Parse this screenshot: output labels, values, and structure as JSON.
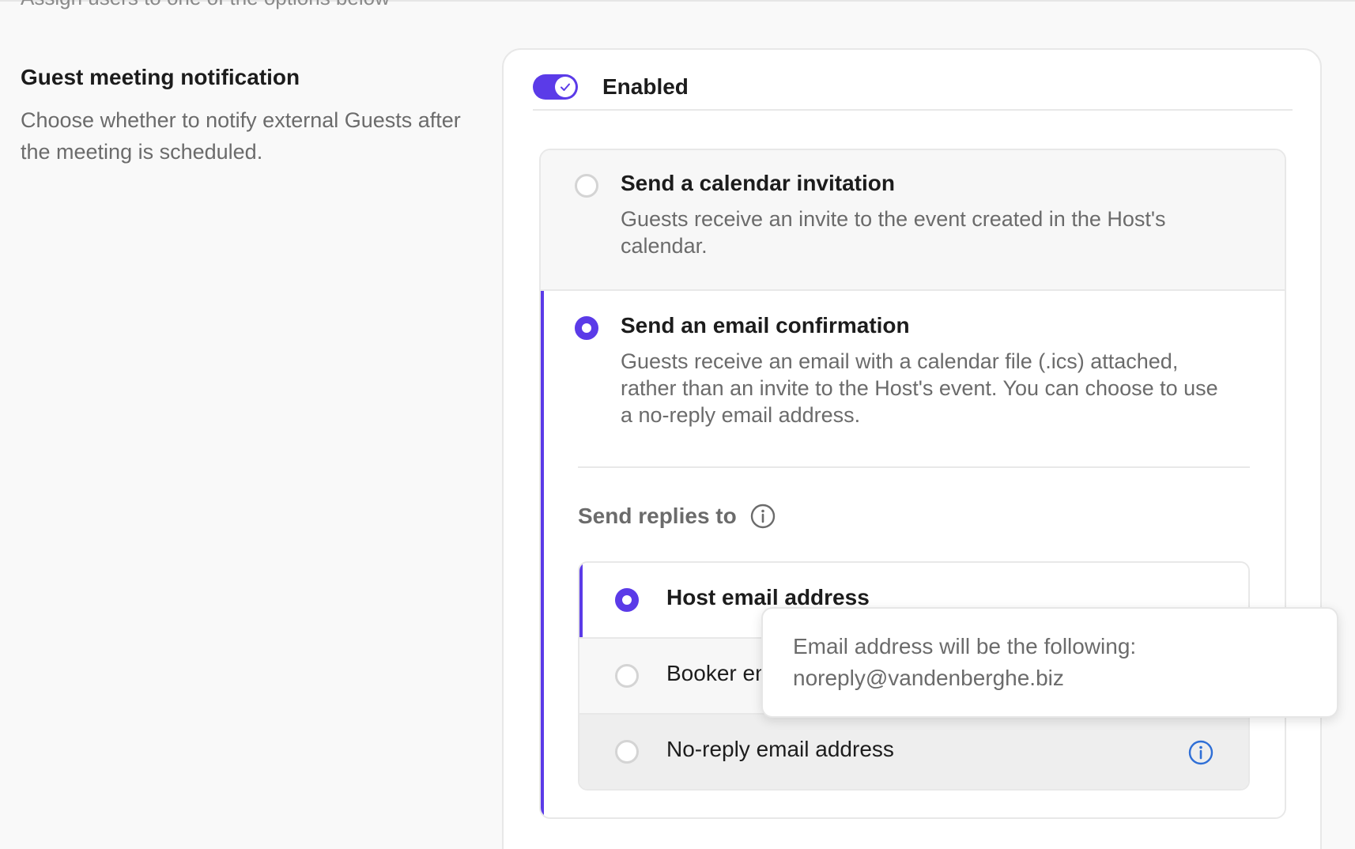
{
  "top_clipped_text": "Assign users to one of the options below",
  "section": {
    "title": "Guest meeting notification",
    "description": "Choose whether to notify external Guests after the meeting is scheduled."
  },
  "toggle": {
    "state": "on",
    "label": "Enabled"
  },
  "options": [
    {
      "title": "Send a calendar invitation",
      "description": "Guests receive an invite to the event created in the Host's calendar.",
      "selected": false
    },
    {
      "title": "Send an email confirmation",
      "description": "Guests receive an email with a calendar file (.ics) attached, rather than an invite to the Host's event. You can choose to use a no-reply email address.",
      "selected": true
    }
  ],
  "send_replies_to": {
    "label": "Send replies to",
    "icon": "info-icon",
    "choices": [
      {
        "label": "Host email address",
        "selected": true
      },
      {
        "label": "Booker email address",
        "selected": false
      },
      {
        "label": "No-reply email address",
        "selected": false,
        "icon": "info-icon"
      }
    ]
  },
  "tooltip": {
    "line1": "Email address will be the following:",
    "line2": "noreply@vandenberghe.biz"
  },
  "colors": {
    "accent": "#5b3be8",
    "info_blue": "#2f6fd6"
  }
}
